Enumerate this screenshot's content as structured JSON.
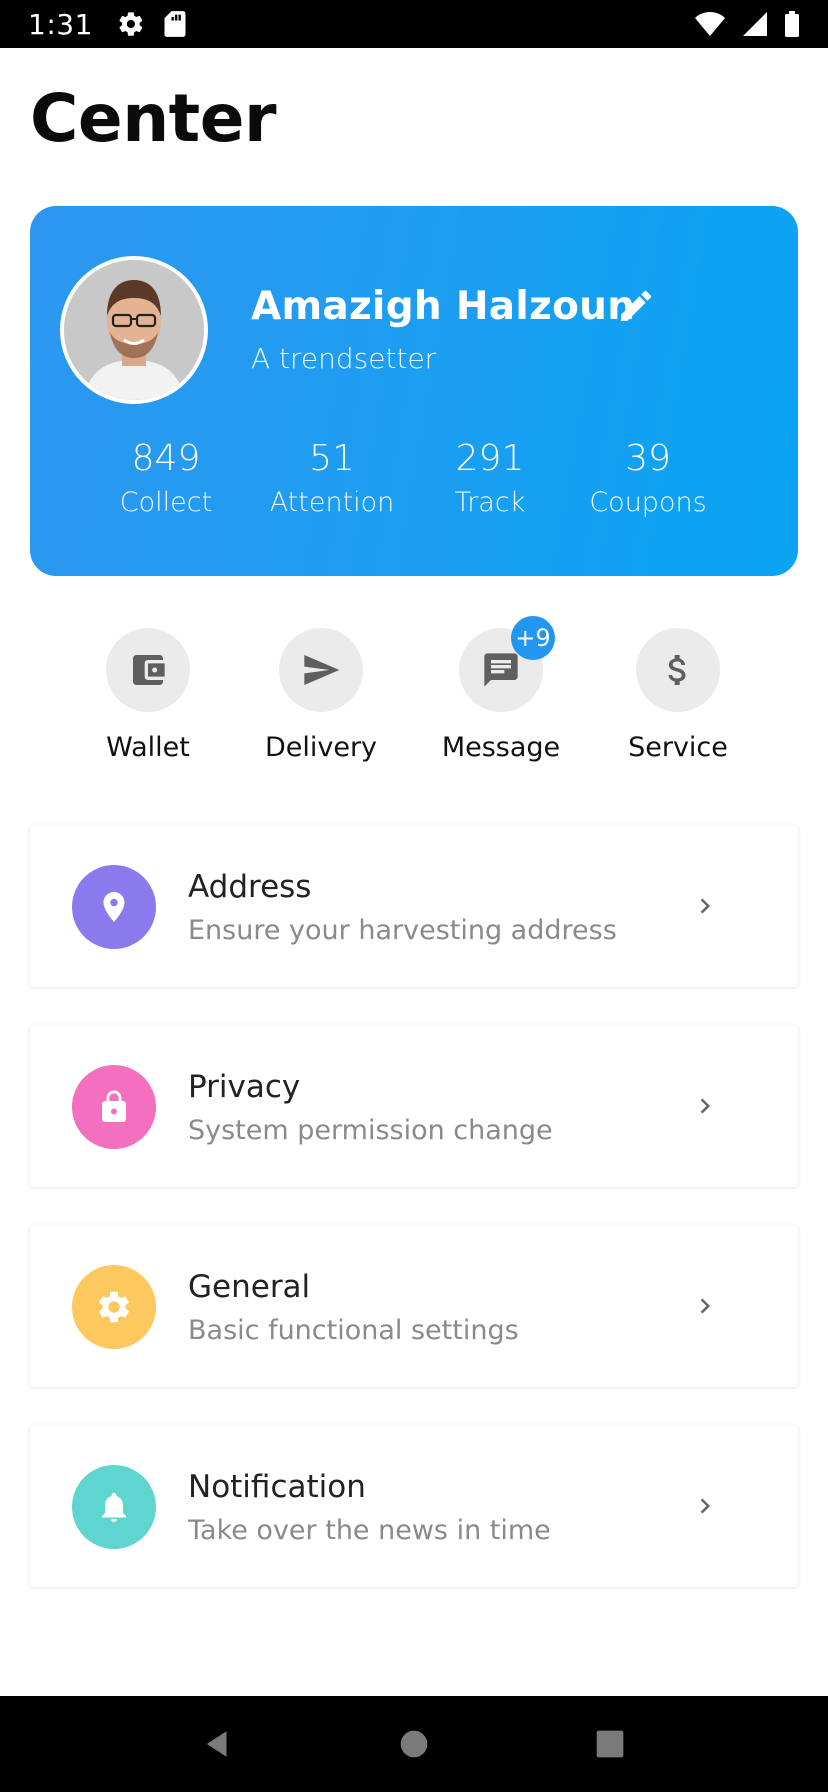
{
  "status_bar": {
    "time": "1:31",
    "icons_left": [
      "settings-gear-icon",
      "sd-card-icon"
    ],
    "icons_right": [
      "wifi-icon",
      "cell-signal-icon",
      "battery-icon"
    ]
  },
  "page": {
    "title": "Center"
  },
  "profile": {
    "name": "Amazigh Halzoun",
    "tagline": "A trendsetter",
    "avatar_icon": "user-photo",
    "stats": [
      {
        "value": "849",
        "label": "Collect"
      },
      {
        "value": "51",
        "label": "Attention"
      },
      {
        "value": "291",
        "label": "Track"
      },
      {
        "value": "39",
        "label": "Coupons"
      }
    ]
  },
  "quick_actions": [
    {
      "label": "Wallet",
      "icon": "wallet-icon"
    },
    {
      "label": "Delivery",
      "icon": "send-icon"
    },
    {
      "label": "Message",
      "icon": "message-icon",
      "badge": "+9"
    },
    {
      "label": "Service",
      "icon": "dollar-icon"
    }
  ],
  "settings": [
    {
      "title": "Address",
      "subtitle": "Ensure your harvesting address",
      "icon": "location-pin-icon",
      "color": "#8b79ee"
    },
    {
      "title": "Privacy",
      "subtitle": "System permission change",
      "icon": "lock-icon",
      "color": "#f46fbe"
    },
    {
      "title": "General",
      "subtitle": "Basic functional settings",
      "icon": "gear-icon",
      "color": "#fdc85d"
    },
    {
      "title": "Notification",
      "subtitle": "Take over the news in time",
      "icon": "bell-icon",
      "color": "#5fd5d0"
    }
  ],
  "colors": {
    "card_gradient_start": "#2e97f0",
    "card_gradient_end": "#0aa4f2",
    "badge": "#2196f3",
    "action_circle": "#ebebeb"
  }
}
